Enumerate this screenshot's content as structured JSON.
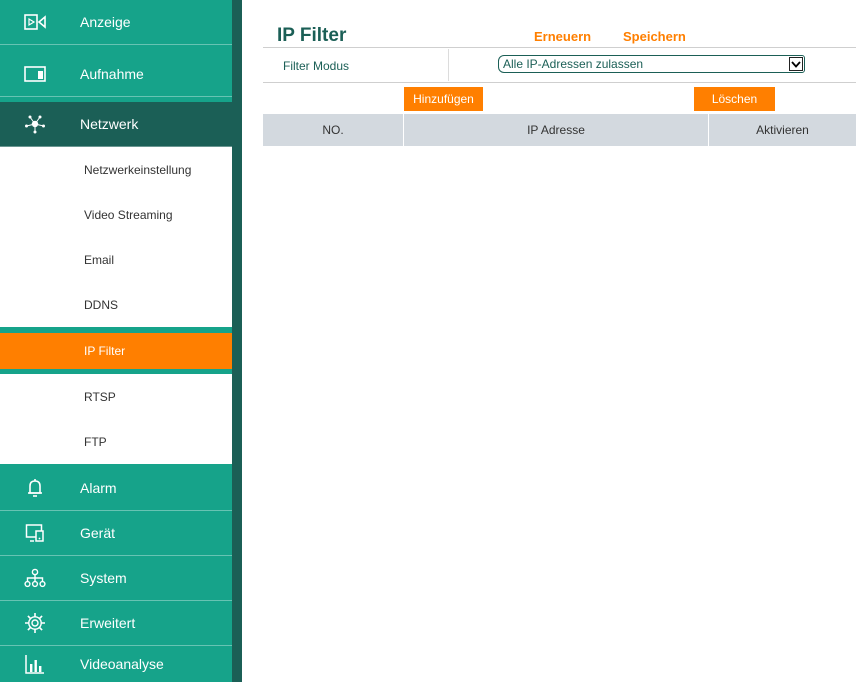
{
  "sidebar": {
    "menu_top": [
      {
        "label": "Anzeige",
        "icon": "video-icon"
      },
      {
        "label": "Aufnahme",
        "icon": "recording-icon"
      },
      {
        "label": "Netzwerk",
        "icon": "network-icon",
        "active": true
      }
    ],
    "submenu": [
      {
        "label": "Netzwerkeinstellung"
      },
      {
        "label": "Video Streaming"
      },
      {
        "label": "Email"
      },
      {
        "label": "DDNS"
      },
      {
        "label": "IP Filter",
        "selected": true
      },
      {
        "label": "RTSP"
      },
      {
        "label": "FTP"
      }
    ],
    "menu_bottom": [
      {
        "label": "Alarm",
        "icon": "bell-icon"
      },
      {
        "label": "Gerät",
        "icon": "device-icon"
      },
      {
        "label": "System",
        "icon": "system-tree-icon"
      },
      {
        "label": "Erweitert",
        "icon": "gear-icon"
      },
      {
        "label": "Videoanalyse",
        "icon": "bar-chart-icon"
      }
    ]
  },
  "main": {
    "title": "IP Filter",
    "refresh_label": "Erneuern",
    "save_label": "Speichern",
    "filter_mode_label": "Filter Modus",
    "filter_mode_value": "Alle IP-Adressen zulassen",
    "add_button": "Hinzufügen",
    "delete_button": "Löschen",
    "table": {
      "columns": [
        "NO.",
        "IP Adresse",
        "Aktivieren"
      ],
      "rows": []
    }
  },
  "colors": {
    "sidebar": "#16a38a",
    "sidebar_dark": "#1b5f56",
    "accent": "#ff7f00",
    "table_header": "#d3d9df"
  }
}
